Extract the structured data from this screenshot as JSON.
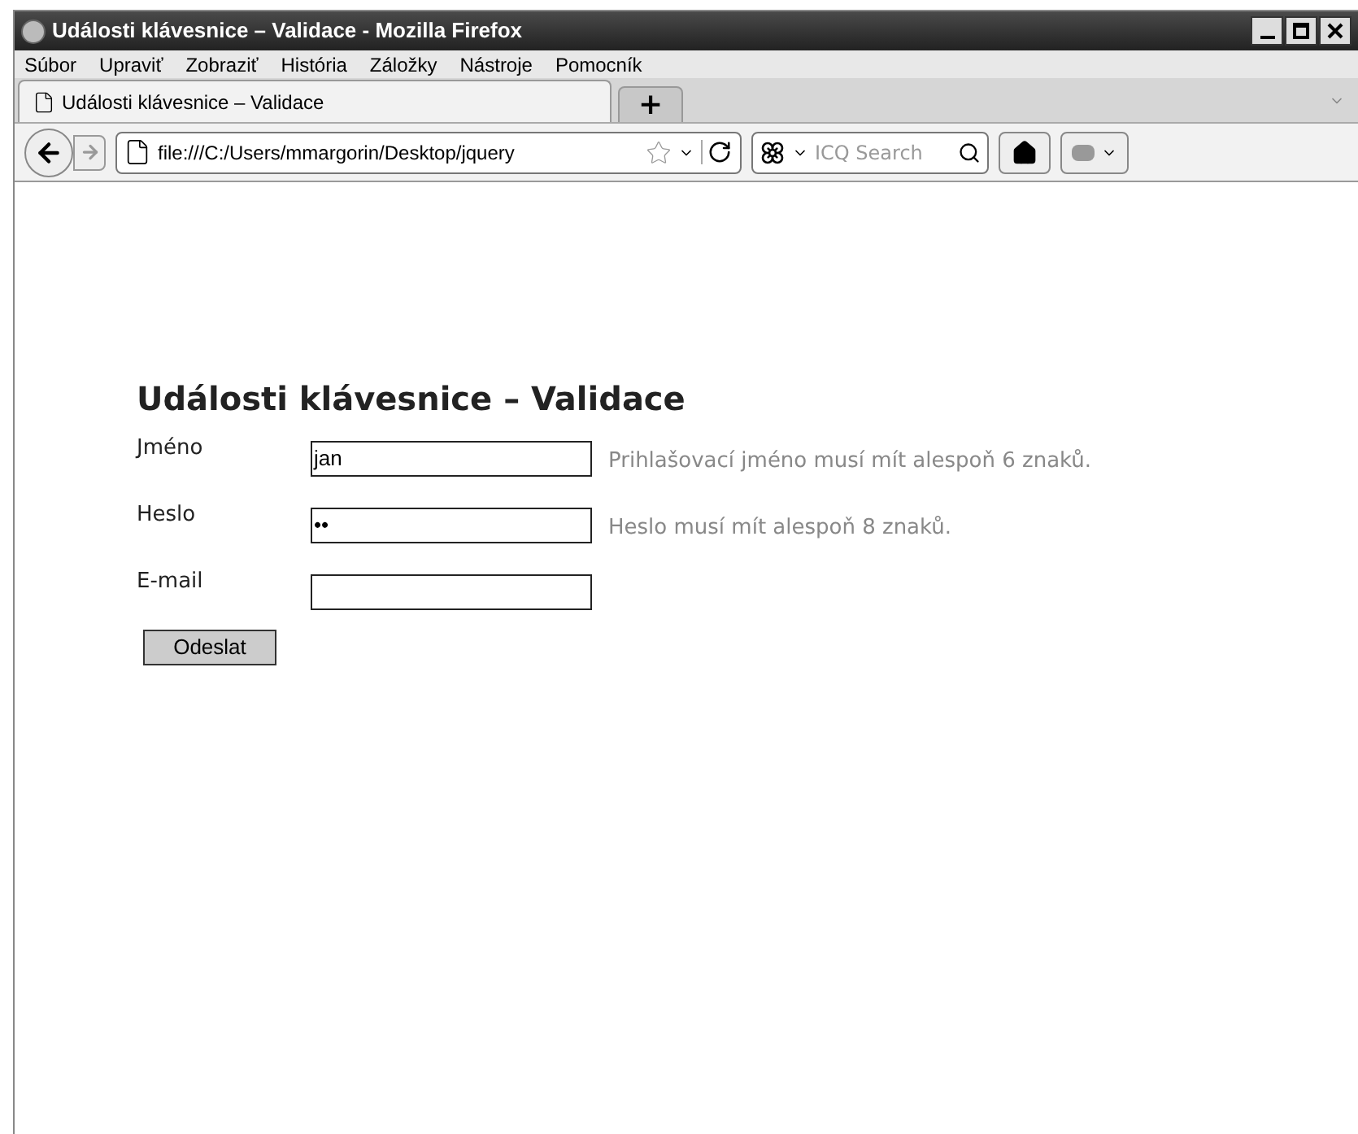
{
  "window": {
    "title": "Události klávesnice – Validace - Mozilla Firefox"
  },
  "menu": [
    {
      "label": "Súbor"
    },
    {
      "label": "Upraviť"
    },
    {
      "label": "Zobraziť"
    },
    {
      "label": "História"
    },
    {
      "label": "Záložky"
    },
    {
      "label": "Nástroje"
    },
    {
      "label": "Pomocník"
    }
  ],
  "tabs": [
    {
      "label": "Události klávesnice – Validace",
      "selected": true
    }
  ],
  "new_tab": "+",
  "address": "file:///C:/Users/mmargorin/Desktop/jquery",
  "search": {
    "placeholder": "ICQ Search"
  },
  "page": {
    "heading": "Události klávesnice – Validace",
    "fields": [
      {
        "label": "Jméno",
        "value": "jan",
        "message": "Prihlašovací jméno musí mít alespoň 6 znaků."
      },
      {
        "label": "Heslo",
        "value": "••",
        "message": "Heslo musí mít alespoň 8 znaků."
      },
      {
        "label": "E-mail"
      }
    ],
    "submit": "Odeslat"
  }
}
